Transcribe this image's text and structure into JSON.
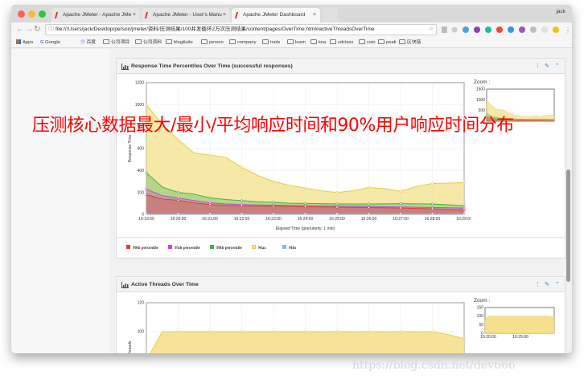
{
  "browser": {
    "user": "jack",
    "tabs": [
      {
        "title": "Apache JMeter - Apache JMe",
        "active": false
      },
      {
        "title": "Apache JMeter - User's Manu",
        "active": false
      },
      {
        "title": "Apache JMeter Dashboard",
        "active": true
      }
    ],
    "url": "file:///Users/jack/Desktop/person/jmeter/资料/压测结果/100并发循环2万次压测结果/content/pages/OverTime.html#activeThreadsOverTime",
    "bookmarks": [
      "Apps",
      "Google",
      "百度",
      "公司项目",
      "公司资料",
      "blog&site",
      "person",
      "company",
      "tools",
      "learn",
      "koa",
      "xdclass",
      "coin",
      "peak",
      "区块链"
    ],
    "close_glyph": "×"
  },
  "overlay_text": "压测核心数据最大/最小/平均响应时间和90%用户响应时间分布",
  "watermark": "https://blog.csdn.net/dev666",
  "panels": [
    {
      "title": "Response Time Percentiles Over Time (successful responses)",
      "zoom_label": "Zoom :",
      "tools": [
        "⋮",
        "✎",
        "⌃"
      ]
    },
    {
      "title": "Active Threads Over Time",
      "zoom_label": "Zoom :",
      "tools": [
        "⋮",
        "✎",
        "⌃"
      ]
    }
  ],
  "colors": {
    "p90": "#e23b3b",
    "p95": "#c04bd6",
    "p99": "#3cb44b",
    "max": "#f3e08a",
    "min": "#8fb6df",
    "max_line": "#e6cc4a",
    "threads": "#f6e08c"
  },
  "chart_data": [
    {
      "type": "area",
      "title": "",
      "xlabel": "Elapsed Time (granularity: 1 min)",
      "ylabel": "Response Time",
      "x": [
        "16:19:00",
        "16:20:00",
        "16:21:00",
        "16:22:00",
        "16:23:00",
        "16:24:00",
        "16:25:00",
        "16:26:00",
        "16:27:00",
        "16:28:00",
        "16:29:00"
      ],
      "x_positions": [
        0,
        0.5,
        1,
        1.5,
        2,
        2.5,
        3,
        3.5,
        4,
        4.5,
        5,
        5.5,
        6,
        6.5,
        7,
        7.5,
        8,
        8.5,
        9,
        9.5,
        10
      ],
      "ylim": [
        0,
        1200
      ],
      "yticks": [
        0,
        200,
        400,
        600,
        800,
        1000,
        1200
      ],
      "series": [
        {
          "name": "90th percentile",
          "values": [
            180,
            140,
            128,
            104,
            90,
            82,
            78,
            76,
            76,
            72,
            70,
            68,
            66,
            64,
            62,
            60,
            58,
            54,
            50,
            45,
            40
          ]
        },
        {
          "name": "95th percentile",
          "values": [
            230,
            170,
            150,
            125,
            106,
            96,
            90,
            86,
            84,
            82,
            80,
            78,
            76,
            74,
            72,
            70,
            68,
            65,
            62,
            60,
            58
          ]
        },
        {
          "name": "99th percentile",
          "values": [
            380,
            250,
            200,
            185,
            150,
            135,
            125,
            115,
            110,
            102,
            100,
            98,
            96,
            95,
            95,
            96,
            98,
            96,
            95,
            88,
            80
          ]
        },
        {
          "name": "Max",
          "values": [
            1000,
            820,
            680,
            560,
            540,
            520,
            430,
            355,
            300,
            265,
            240,
            215,
            200,
            215,
            245,
            235,
            210,
            255,
            282,
            285,
            290
          ]
        },
        {
          "name": "Min",
          "values": [
            5,
            5,
            5,
            5,
            5,
            5,
            5,
            5,
            5,
            5,
            5,
            5,
            5,
            5,
            5,
            5,
            5,
            5,
            5,
            5,
            5
          ]
        }
      ],
      "legend": [
        "90th percentile",
        "95th percentile",
        "99th percentile",
        "Max",
        "Min"
      ],
      "zoom": {
        "yticks": [
          0,
          500,
          1000,
          1500
        ],
        "ylim": [
          0,
          1500
        ]
      }
    },
    {
      "type": "area",
      "title": "",
      "xlabel": "",
      "ylabel": "e threads",
      "x_positions": [
        0,
        0.5,
        1,
        1.5,
        2,
        2.5,
        3,
        3.5,
        4,
        4.5,
        5,
        5.5,
        6,
        6.5,
        7,
        7.5,
        8,
        8.5,
        9,
        9.5,
        10
      ],
      "ylim": [
        60,
        120
      ],
      "yticks": [
        80,
        100,
        120
      ],
      "series": [
        {
          "name": "",
          "values": [
            80,
            100,
            100,
            100,
            100,
            100,
            100,
            100,
            100,
            100,
            100,
            100,
            100,
            100,
            100,
            100,
            100,
            100,
            100,
            98,
            95
          ]
        }
      ],
      "zoom": {
        "yticks": [
          0,
          50,
          100,
          150
        ],
        "ylim": [
          0,
          150
        ],
        "x": [
          "16:20:00",
          "16:25:00"
        ]
      }
    }
  ]
}
